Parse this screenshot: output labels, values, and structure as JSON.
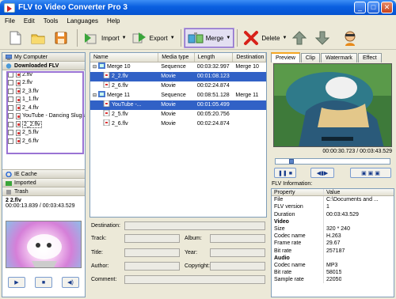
{
  "window": {
    "title": "FLV to Video Converter Pro 3"
  },
  "menu": [
    "File",
    "Edit",
    "Tools",
    "Languages",
    "Help"
  ],
  "toolbar": {
    "import": "Import",
    "export": "Export",
    "merge": "Merge",
    "delete": "Delete"
  },
  "nav": {
    "my_computer": "My Computer",
    "downloaded": "Downloaded FLV",
    "ie_cache": "IE Cache",
    "imported": "Imported",
    "trash": "Trash"
  },
  "files": [
    {
      "name": "2.flv",
      "selected": false
    },
    {
      "name": "2.flv",
      "selected": false
    },
    {
      "name": "2_3.flv",
      "selected": false
    },
    {
      "name": "1_1.flv",
      "selected": false
    },
    {
      "name": "2_4.flv",
      "selected": false
    },
    {
      "name": "YouTube - Dancing Slugs",
      "selected": false
    },
    {
      "name": "2_2.flv",
      "selected": true
    },
    {
      "name": "2_5.flv",
      "selected": false
    },
    {
      "name": "2_6.flv",
      "selected": false
    }
  ],
  "left_clip": {
    "name": "2  2.flv",
    "time": "00:00:13.839 / 00:03:43.529"
  },
  "grid": {
    "columns": [
      "Name",
      "Media type",
      "Length",
      "Destination"
    ],
    "rows": [
      {
        "level": 0,
        "name": "Merge 10",
        "type": "Sequence",
        "length": "00:03:32.997",
        "dest": "Merge 10",
        "selected": false
      },
      {
        "level": 1,
        "name": "2_2.flv",
        "type": "Movie",
        "length": "00:01:08.123",
        "dest": "",
        "selected": true
      },
      {
        "level": 1,
        "name": "2_6.flv",
        "type": "Movie",
        "length": "00:02:24.874",
        "dest": "",
        "selected": false
      },
      {
        "level": 0,
        "name": "Merge 11",
        "type": "Sequence",
        "length": "00:08:51.128",
        "dest": "Merge 11",
        "selected": false
      },
      {
        "level": 1,
        "name": "YouTube -...",
        "type": "Movie",
        "length": "00:01:05.499",
        "dest": "",
        "selected": true
      },
      {
        "level": 1,
        "name": "2_5.flv",
        "type": "Movie",
        "length": "00:05:20.756",
        "dest": "",
        "selected": false
      },
      {
        "level": 1,
        "name": "2_6.flv",
        "type": "Movie",
        "length": "00:02:24.874",
        "dest": "",
        "selected": false
      }
    ]
  },
  "form": {
    "destination": "Destination:",
    "track": "Track:",
    "album": "Album:",
    "title": "Title:",
    "year": "Year:",
    "author": "Author:",
    "copyright": "Copyright:",
    "comment": "Comment:"
  },
  "tabs": [
    "Preview",
    "Clip",
    "Watermark",
    "Effect"
  ],
  "preview": {
    "time": "00:00:30.723 / 00:03:43.529",
    "progress": 0.12
  },
  "flv_info": {
    "label": "FLV Information:",
    "header": [
      "Property",
      "Value"
    ],
    "rows": [
      {
        "k": "File",
        "v": "C:\\Documents and ...",
        "section": false
      },
      {
        "k": "FLV version",
        "v": "1",
        "section": false
      },
      {
        "k": "Duration",
        "v": "00:03:43.529",
        "section": false
      },
      {
        "k": "Video",
        "v": "",
        "section": true
      },
      {
        "k": "Size",
        "v": "320 * 240",
        "section": false
      },
      {
        "k": "Codec name",
        "v": "H.263",
        "section": false
      },
      {
        "k": "Frame rate",
        "v": "29.67",
        "section": false
      },
      {
        "k": "Bit rate",
        "v": "257187",
        "section": false
      },
      {
        "k": "Audio",
        "v": "",
        "section": true
      },
      {
        "k": "Codec name",
        "v": "MP3",
        "section": false
      },
      {
        "k": "Bit rate",
        "v": "58015",
        "section": false
      },
      {
        "k": "Sample rate",
        "v": "22050",
        "section": false
      }
    ]
  }
}
